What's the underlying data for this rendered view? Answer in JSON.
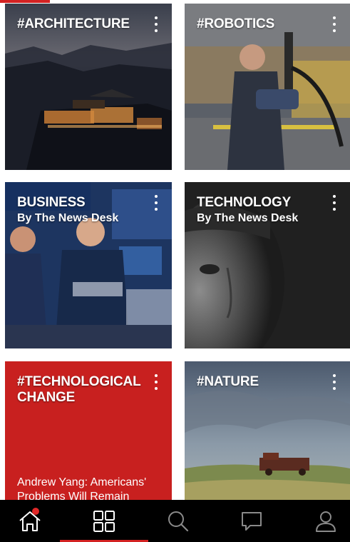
{
  "tiles": [
    {
      "title": "#ARCHITECTURE",
      "byline": "",
      "story": ""
    },
    {
      "title": "#ROBOTICS",
      "byline": "",
      "story": ""
    },
    {
      "title": "BUSINESS",
      "byline": "By The News Desk",
      "story": ""
    },
    {
      "title": "TECHNOLOGY",
      "byline": "By The News Desk",
      "story": ""
    },
    {
      "title": "#TECHNOLOGICAL CHANGE",
      "byline": "",
      "story": "Andrew Yang: Americans' Problems Will Remain"
    },
    {
      "title": "#NATURE",
      "byline": "",
      "story": ""
    }
  ],
  "nav": {
    "items": [
      {
        "icon": "home-icon",
        "badge": true
      },
      {
        "icon": "grid-icon",
        "active": true
      },
      {
        "icon": "search-icon"
      },
      {
        "icon": "chat-icon"
      },
      {
        "icon": "profile-icon"
      }
    ]
  },
  "colors": {
    "accent": "#d32222",
    "nav_bg": "#000000",
    "tile_red": "#c8201f"
  }
}
